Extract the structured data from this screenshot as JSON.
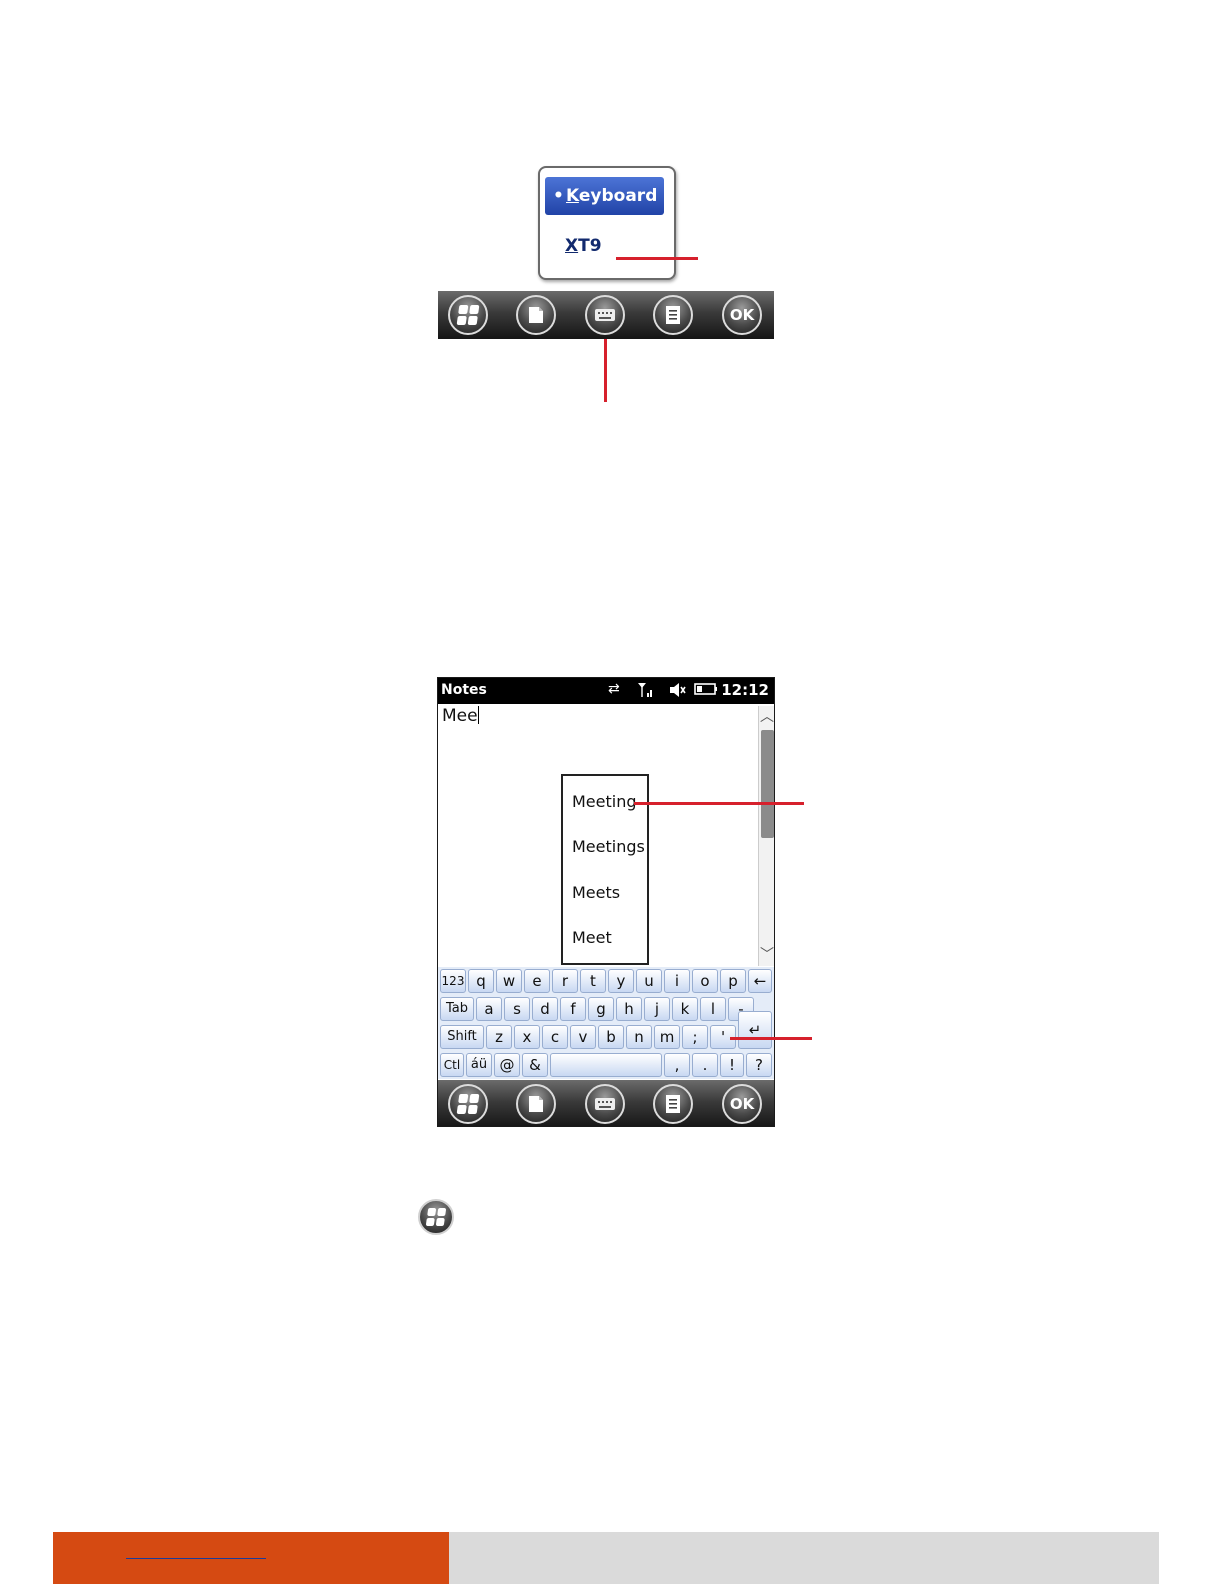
{
  "input_menu": {
    "selected_bullet": "•",
    "selected_label_first": "K",
    "selected_label_rest": "eyboard",
    "item_label_first": "X",
    "item_label_rest": "T9"
  },
  "taskbar": {
    "ok_label": "OK"
  },
  "device": {
    "app_title": "Notes",
    "clock": "12:12",
    "note_text": "Mee",
    "suggestions": [
      "Meeting",
      "Meetings",
      "Meets",
      "Meet"
    ]
  },
  "keyboard": {
    "rows": [
      [
        "123",
        "q",
        "w",
        "e",
        "r",
        "t",
        "y",
        "u",
        "i",
        "o",
        "p",
        "←"
      ],
      [
        "Tab",
        "a",
        "s",
        "d",
        "f",
        "g",
        "h",
        "j",
        "k",
        "l",
        "-"
      ],
      [
        "Shift",
        "z",
        "x",
        "c",
        "v",
        "b",
        "n",
        "m",
        ";",
        "'",
        "↵"
      ],
      [
        "Ctl",
        "áü",
        "@",
        "&",
        " ",
        ",",
        ".",
        "!",
        "?"
      ]
    ]
  },
  "colors": {
    "callout": "#d6202c",
    "footer_accent": "#d54a12",
    "footer_gray": "#dadada",
    "menu_selected": "#2f56c0"
  }
}
